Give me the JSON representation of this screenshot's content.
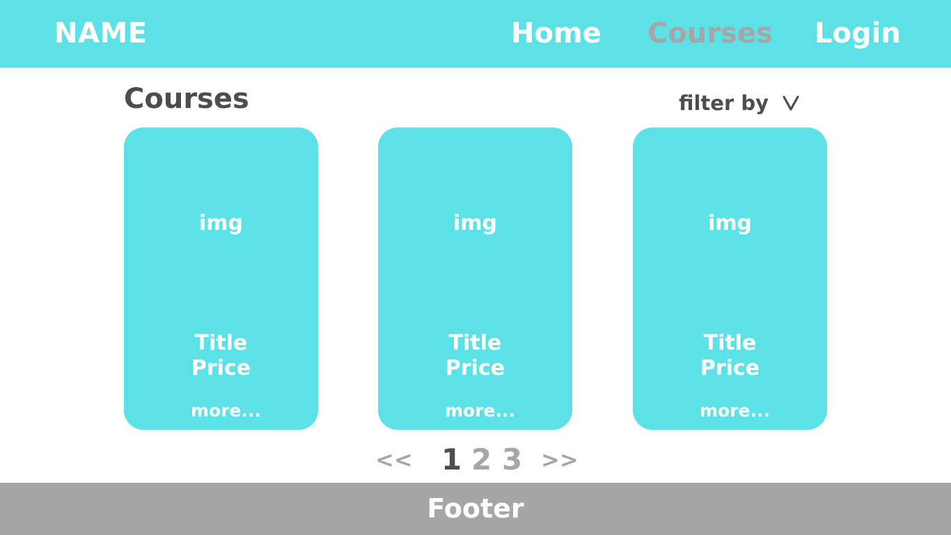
{
  "header": {
    "brand": "NAME",
    "nav": {
      "home": "Home",
      "courses": "Courses",
      "login": "Login"
    },
    "active_nav": "courses"
  },
  "main": {
    "title": "Courses",
    "filter_label": "filter by",
    "filter_icon": "chevron-down-icon"
  },
  "cards": [
    {
      "img": "img",
      "title": "Title",
      "price": "Price",
      "more": "more..."
    },
    {
      "img": "img",
      "title": "Title",
      "price": "Price",
      "more": "more..."
    },
    {
      "img": "img",
      "title": "Title",
      "price": "Price",
      "more": "more..."
    }
  ],
  "pagination": {
    "prev": "<<",
    "pages": [
      "1",
      "2",
      "3"
    ],
    "current": "1",
    "next": ">>"
  },
  "footer": {
    "label": "Footer"
  },
  "colors": {
    "accent": "#5ce1e6",
    "muted": "#a6a6a6",
    "text_dark": "#4d4d4d",
    "text_light": "#ffffff"
  }
}
